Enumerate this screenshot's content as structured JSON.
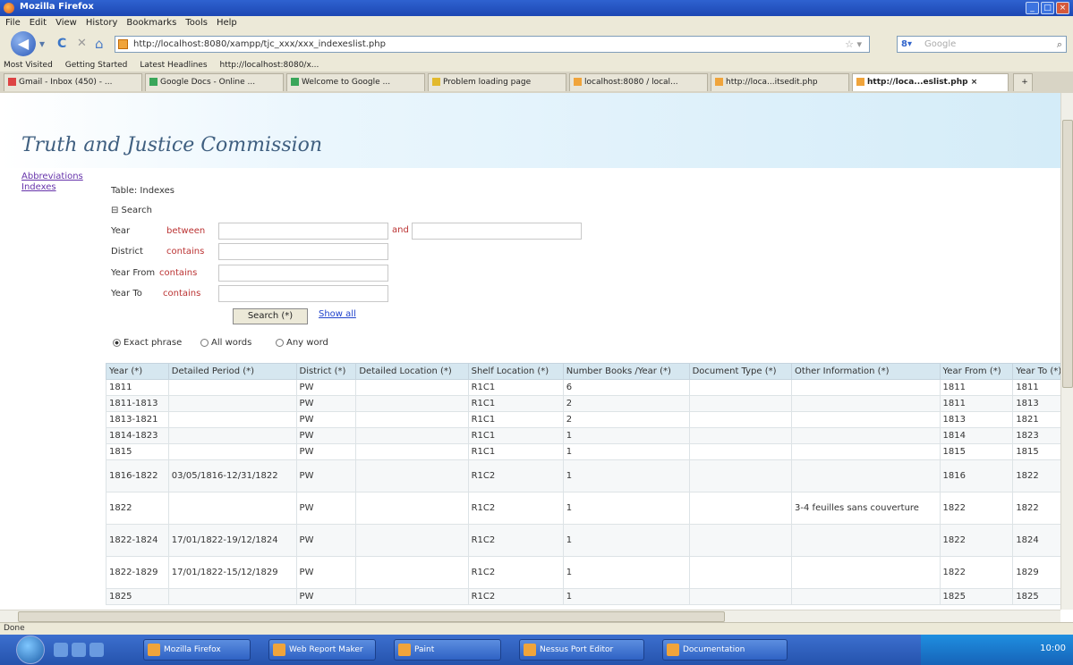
{
  "window": {
    "title": "Mozilla Firefox"
  },
  "menu": [
    "File",
    "Edit",
    "View",
    "History",
    "Bookmarks",
    "Tools",
    "Help"
  ],
  "nav": {
    "url": "http://localhost:8080/xampp/tjc_xxx/xxx_indexeslist.php",
    "search_placeholder": "Google"
  },
  "bookmarks": [
    "Most Visited",
    "Getting Started",
    "Latest Headlines",
    "http://localhost:8080/x..."
  ],
  "tabs": [
    {
      "label": "Gmail - Inbox (450) - ...",
      "icon": "mail-icon"
    },
    {
      "label": "Google Docs - Online ...",
      "icon": "docs-icon"
    },
    {
      "label": "Welcome to Google ...",
      "icon": "google-icon"
    },
    {
      "label": "Problem loading page",
      "icon": "warning-icon"
    },
    {
      "label": "localhost:8080 / local...",
      "icon": "page-icon"
    },
    {
      "label": "http://loca...itsedit.php",
      "icon": "page-icon"
    },
    {
      "label": "http://loca...eslist.php",
      "icon": "page-icon",
      "active": true
    }
  ],
  "site": {
    "title": "Truth and Justice Commission"
  },
  "sidebar": {
    "links": [
      "Abbreviations",
      "Indexes"
    ]
  },
  "page": {
    "table_name": "Table: Indexes"
  },
  "search": {
    "toggle_label": "⊟ Search",
    "fields": [
      {
        "label": "Year",
        "operator": "between",
        "value": "",
        "and_label": "and",
        "value2": ""
      },
      {
        "label": "District",
        "operator": "contains",
        "value": ""
      },
      {
        "label": "Year From",
        "operator": "contains",
        "value": ""
      },
      {
        "label": "Year To",
        "operator": "contains",
        "value": ""
      }
    ],
    "search_button": "Search (*)",
    "show_all": "Show all",
    "options": [
      {
        "label": "Exact phrase",
        "selected": true
      },
      {
        "label": "All words",
        "selected": false
      },
      {
        "label": "Any word",
        "selected": false
      }
    ]
  },
  "table": {
    "columns": [
      "Year (*)",
      "Detailed Period (*)",
      "District (*)",
      "Detailed Location (*)",
      "Shelf Location (*)",
      "Number Books /Year (*)",
      "Document Type (*)",
      "Other Information (*)",
      "Year From (*)",
      "Year To (*)"
    ],
    "rows": [
      {
        "h": 1,
        "cells": [
          "1811",
          "",
          "PW",
          "",
          "R1C1",
          "6",
          "",
          "",
          "1811",
          "1811"
        ]
      },
      {
        "h": 1,
        "cells": [
          "1811-1813",
          "",
          "PW",
          "",
          "R1C1",
          "2",
          "",
          "",
          "1811",
          "1813"
        ]
      },
      {
        "h": 1,
        "cells": [
          "1813-1821",
          "",
          "PW",
          "",
          "R1C1",
          "2",
          "",
          "",
          "1813",
          "1821"
        ]
      },
      {
        "h": 1,
        "cells": [
          "1814-1823",
          "",
          "PW",
          "",
          "R1C1",
          "1",
          "",
          "",
          "1814",
          "1823"
        ]
      },
      {
        "h": 1,
        "cells": [
          "1815",
          "",
          "PW",
          "",
          "R1C1",
          "1",
          "",
          "",
          "1815",
          "1815"
        ]
      },
      {
        "h": 2,
        "cells": [
          "1816-1822",
          "03/05/1816-12/31/1822",
          "PW",
          "",
          "R1C2",
          "1",
          "",
          "",
          "1816",
          "1822"
        ]
      },
      {
        "h": 2,
        "cells": [
          "1822",
          "",
          "PW",
          "",
          "R1C2",
          "1",
          "",
          "3-4 feuilles sans couverture",
          "1822",
          "1822"
        ]
      },
      {
        "h": 2,
        "cells": [
          "1822-1824",
          "17/01/1822-19/12/1824",
          "PW",
          "",
          "R1C2",
          "1",
          "",
          "",
          "1822",
          "1824"
        ]
      },
      {
        "h": 2,
        "cells": [
          "1822-1829",
          "17/01/1822-15/12/1829",
          "PW",
          "",
          "R1C2",
          "1",
          "",
          "",
          "1822",
          "1829"
        ]
      },
      {
        "h": 1,
        "cells": [
          "1825",
          "",
          "PW",
          "",
          "R1C2",
          "1",
          "",
          "",
          "1825",
          "1825"
        ]
      }
    ]
  },
  "status": {
    "text": "Done"
  },
  "taskbar": {
    "tasks": [
      "Mozilla Firefox",
      "Web Report Maker",
      "Paint",
      "Nessus Port Editor",
      "Documentation"
    ],
    "clock": "10:00"
  }
}
